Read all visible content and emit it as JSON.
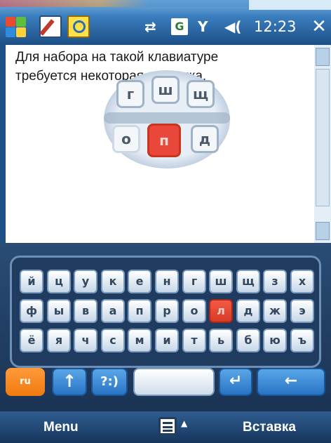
{
  "status_bar": {
    "sync_glyph": "⇄",
    "g_label": "G",
    "signal_glyph": "Y",
    "volume_glyph": "◀(",
    "time": "12:23",
    "close_label": "✕"
  },
  "content": {
    "message_line1": "Для набора на такой клавиатуре",
    "message_line2": "требуется некоторая практика."
  },
  "illustration": {
    "keys": [
      "г",
      "ш",
      "щ",
      "о",
      "п",
      "д"
    ],
    "highlight_key": "п"
  },
  "keyboard": {
    "row1": [
      "й",
      "ц",
      "у",
      "к",
      "е",
      "н",
      "г",
      "ш",
      "щ",
      "з",
      "х"
    ],
    "row2": [
      "ф",
      "ы",
      "в",
      "а",
      "п",
      "р",
      "о",
      "л",
      "д",
      "ж",
      "э"
    ],
    "row3": [
      "ё",
      "я",
      "ч",
      "с",
      "м",
      "и",
      "т",
      "ь",
      "б",
      "ю",
      "ъ"
    ],
    "highlighted_key": "л",
    "lang_label": "ru",
    "shift_label": "↑",
    "symbols_label": "?:)",
    "enter_label": "↵",
    "backspace_label": "←"
  },
  "softkeys": {
    "left": "Menu",
    "right": "Вставка"
  },
  "colors": {
    "accent_red": "#e8473a",
    "lang_orange": "#f07a10",
    "blue_key": "#2874c4"
  }
}
